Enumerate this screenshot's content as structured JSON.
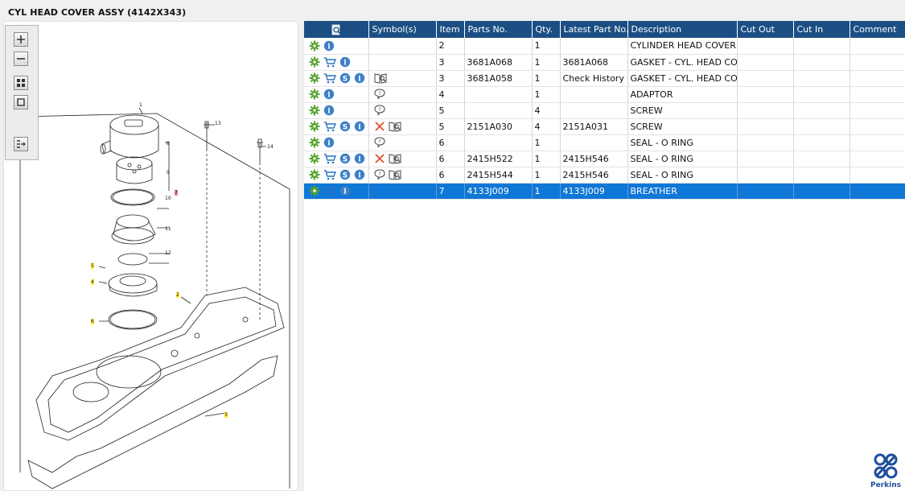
{
  "title": "CYL HEAD COVER ASSY (4142X343)",
  "colors": {
    "header_bg": "#1b4f84",
    "selected_bg": "#0f77d6",
    "brand": "#1f4f9a",
    "gear": "#5aa532",
    "info": "#3c7fc8"
  },
  "toolbar": {
    "buttons": [
      {
        "name": "zoom-in",
        "icon": "plus-icon"
      },
      {
        "name": "zoom-out",
        "icon": "minus-icon"
      },
      {
        "name": "fit",
        "icon": "grid-icon"
      },
      {
        "name": "actual-size",
        "icon": "square-icon"
      },
      {
        "name": "toggle-list",
        "icon": "list-arrow-icon"
      }
    ]
  },
  "diagram": {
    "callouts": [
      "1",
      "13",
      "14",
      "8",
      "9",
      "10",
      "11",
      "12",
      "5",
      "4",
      "2",
      "6",
      "3",
      "7"
    ]
  },
  "table": {
    "columns": [
      "",
      "Symbol(s)",
      "Item",
      "Parts No.",
      "Qty.",
      "Latest Part No.",
      "Description",
      "Cut Out",
      "Cut In",
      "Comment"
    ],
    "rows": [
      {
        "actions": [
          "gear",
          "info"
        ],
        "symbols": [],
        "item": "2",
        "part_no": "",
        "qty": "1",
        "latest": "",
        "desc": "CYLINDER HEAD COVER",
        "selected": false
      },
      {
        "actions": [
          "gear",
          "cart",
          "info"
        ],
        "symbols": [],
        "item": "3",
        "part_no": "3681A068",
        "qty": "1",
        "latest": "3681A068",
        "desc": "GASKET - CYL. HEAD COVE",
        "selected": false
      },
      {
        "actions": [
          "gear",
          "cart",
          "s",
          "info"
        ],
        "symbols": [
          "book"
        ],
        "item": "3",
        "part_no": "3681A058",
        "qty": "1",
        "latest": "Check History",
        "desc": "GASKET - CYL. HEAD COVE",
        "selected": false
      },
      {
        "actions": [
          "gear",
          "info"
        ],
        "symbols": [
          "bubble"
        ],
        "item": "4",
        "part_no": "",
        "qty": "1",
        "latest": "",
        "desc": "ADAPTOR",
        "selected": false
      },
      {
        "actions": [
          "gear",
          "info"
        ],
        "symbols": [
          "bubble"
        ],
        "item": "5",
        "part_no": "",
        "qty": "4",
        "latest": "",
        "desc": "SCREW",
        "selected": false
      },
      {
        "actions": [
          "gear",
          "cart",
          "s",
          "info"
        ],
        "symbols": [
          "x",
          "book"
        ],
        "item": "5",
        "part_no": "2151A030",
        "qty": "4",
        "latest": "2151A031",
        "desc": "SCREW",
        "selected": false
      },
      {
        "actions": [
          "gear",
          "info"
        ],
        "symbols": [
          "bubble"
        ],
        "item": "6",
        "part_no": "",
        "qty": "1",
        "latest": "",
        "desc": "SEAL - O RING",
        "selected": false
      },
      {
        "actions": [
          "gear",
          "cart",
          "s",
          "info"
        ],
        "symbols": [
          "x",
          "book"
        ],
        "item": "6",
        "part_no": "2415H522",
        "qty": "1",
        "latest": "2415H546",
        "desc": "SEAL - O RING",
        "selected": false
      },
      {
        "actions": [
          "gear",
          "cart",
          "s",
          "info"
        ],
        "symbols": [
          "bubble",
          "book"
        ],
        "item": "6",
        "part_no": "2415H544",
        "qty": "1",
        "latest": "2415H546",
        "desc": "SEAL - O RING",
        "selected": false
      },
      {
        "actions": [
          "gear",
          "cart",
          "info"
        ],
        "symbols": [],
        "item": "7",
        "part_no": "4133J009",
        "qty": "1",
        "latest": "4133J009",
        "desc": "BREATHER",
        "selected": true
      }
    ]
  },
  "brand": {
    "name": "Perkins"
  }
}
